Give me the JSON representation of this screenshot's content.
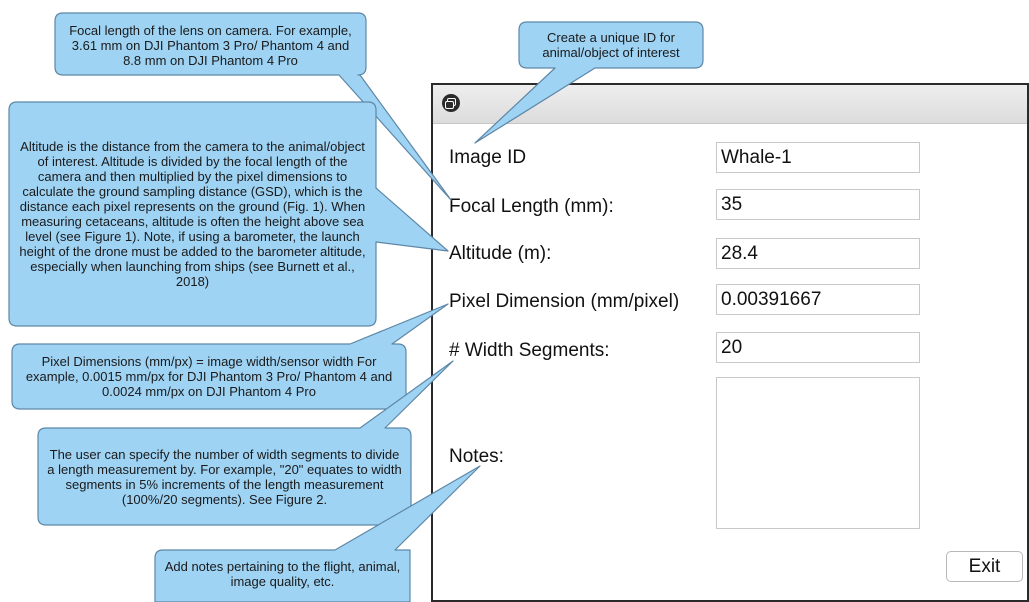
{
  "window": {
    "title": "",
    "icon": "window-app-icon"
  },
  "form": {
    "image_id_label": "Image ID",
    "image_id_value": "Whale-1",
    "focal_length_label": "Focal Length (mm):",
    "focal_length_value": "35",
    "altitude_label": "Altitude (m):",
    "altitude_value": "28.4",
    "pixel_dimension_label": "Pixel Dimension (mm/pixel)",
    "pixel_dimension_value": "0.00391667",
    "width_segments_label": "# Width Segments:",
    "width_segments_value": "20",
    "notes_label": "Notes:",
    "notes_value": "",
    "exit_label": "Exit"
  },
  "callouts": {
    "focal_length": "Focal length of the lens on camera. For example, 3.61 mm on DJI Phantom 3 Pro/ Phantom 4 and 8.8 mm on DJI Phantom 4 Pro",
    "image_id": "Create a unique ID for animal/object of interest",
    "altitude": "Altitude is the distance from the camera to the animal/object of interest. Altitude is divided by the focal length of the camera and then multiplied by the pixel dimensions to calculate the ground sampling distance (GSD), which is the distance each pixel represents on the ground (Fig. 1). When measuring cetaceans, altitude is often the height above sea level (see Figure 1). Note, if using a barometer, the launch height of the drone must be added to the barometer altitude, especially when launching from ships (see Burnett et al., 2018)",
    "pixel_dimensions": "Pixel Dimensions (mm/px) = image width/sensor width For example, 0.0015 mm/px for DJI Phantom 3 Pro/ Phantom 4 and 0.0024 mm/px on DJI Phantom 4 Pro",
    "width_segments": "The user can specify the number of width segments to divide a length measurement by. For example, \"20\" equates to width segments in 5% increments of the length measurement (100%/20 segments). See Figure 2.",
    "notes": "Add notes pertaining to the flight, animal, image quality, etc."
  },
  "colors": {
    "callout_fill": "#9fd3f4",
    "callout_stroke": "#5e87a6",
    "window_border": "#2a2a2a",
    "input_border": "#c9c9c9"
  }
}
